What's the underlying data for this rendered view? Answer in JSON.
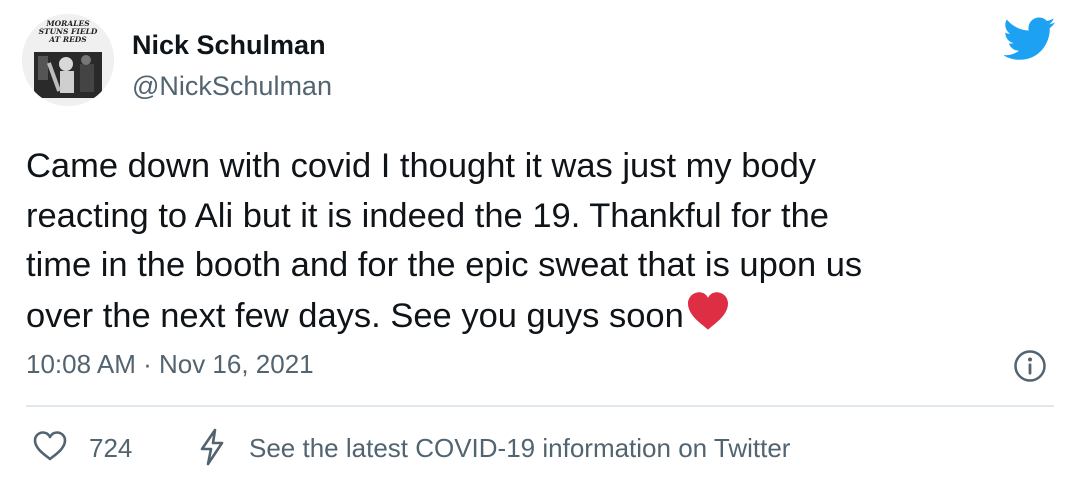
{
  "author": {
    "name": "Nick Schulman",
    "handle": "@NickSchulman",
    "avatar_caption": "MORALES STUNS FIELD AT REDS"
  },
  "tweet": {
    "lines": [
      "Came down with covid I thought it was just my body",
      "reacting to Ali but it is indeed the 19. Thankful for the",
      "time in the booth and for the epic sweat that is upon us",
      "over the next few days. See you guys soon"
    ],
    "emoji": "red-heart"
  },
  "meta": {
    "timestamp": "10:08 AM · Nov 16, 2021"
  },
  "actions": {
    "like_count": "724",
    "covid_info": "See the latest COVID-19 information on Twitter"
  },
  "icons": {
    "brand": "twitter-bird-icon",
    "info": "info-icon",
    "like": "heart-outline-icon",
    "covid": "lightning-bolt-icon"
  },
  "colors": {
    "twitter_blue": "#1DA1F2",
    "text_primary": "#0f1419",
    "text_secondary": "#536471",
    "heart_red": "#dd2e44",
    "divider": "#e1e8ed"
  }
}
